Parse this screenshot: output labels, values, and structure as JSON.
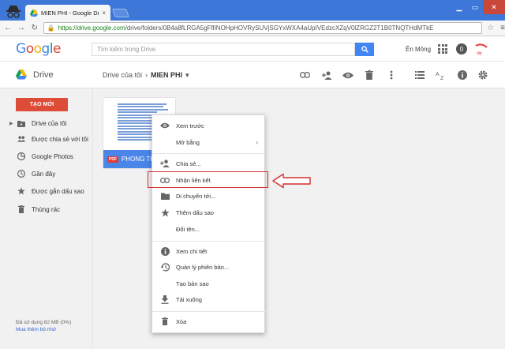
{
  "browser": {
    "tab_title": "MIEN PHI - Google Drive",
    "tab_close": "×",
    "url_host": "https://drive.google.com",
    "url_path": "/drive/folders/0B4a8fLRGA5gFflINOHpHOVRySUVjSGYxWXA4aUpIVEdzcXZqV0lZRGZ2T1B0TNQTHdMTkE"
  },
  "header": {
    "search_placeholder": "Tìm kiếm trong Drive",
    "user_name": "Ên Mông"
  },
  "toolbar": {
    "app_name": "Drive",
    "breadcrumb_parent": "Drive của tôi",
    "breadcrumb_sep": "›",
    "breadcrumb_current": "MIEN PHI",
    "breadcrumb_caret": "▾"
  },
  "sidebar": {
    "new_button": "TẠO MỚI",
    "items": [
      {
        "label": "Drive của tôi",
        "icon": "drive-folder-icon"
      },
      {
        "label": "Được chia sẻ với tôi",
        "icon": "people-icon"
      },
      {
        "label": "Google Photos",
        "icon": "photos-icon"
      },
      {
        "label": "Gần đây",
        "icon": "clock-icon"
      },
      {
        "label": "Được gắn dấu sao",
        "icon": "star-icon"
      },
      {
        "label": "Thùng rác",
        "icon": "trash-icon"
      }
    ],
    "storage_used": "Đã sử dụng 82 MB (0%)",
    "buy_storage": "Mua thêm bộ nhớ"
  },
  "file": {
    "badge": "PDF",
    "name": "PHONG THA"
  },
  "context_menu": {
    "items": [
      {
        "label": "Xem trước",
        "icon": "eye-icon"
      },
      {
        "label": "Mở bằng",
        "icon": "",
        "submenu": "›"
      },
      {
        "label": "Chia sẻ...",
        "icon": "add-person-icon"
      },
      {
        "label": "Nhận liên kết",
        "icon": "link-icon"
      },
      {
        "label": "Di chuyển tới...",
        "icon": "folder-icon"
      },
      {
        "label": "Thêm dấu sao",
        "icon": "star-icon"
      },
      {
        "label": "Đổi tên...",
        "icon": ""
      },
      {
        "label": "Xem chi tiết",
        "icon": "info-icon"
      },
      {
        "label": "Quản lý phiên bản...",
        "icon": "history-icon"
      },
      {
        "label": "Tạo bản sao",
        "icon": ""
      },
      {
        "label": "Tải xuống",
        "icon": "download-icon"
      },
      {
        "label": "Xóa",
        "icon": "trash-icon"
      }
    ]
  },
  "colors": {
    "new_button": "#dd4b39",
    "highlight": "#d32f2f",
    "file_footer": "#4a86e8"
  }
}
